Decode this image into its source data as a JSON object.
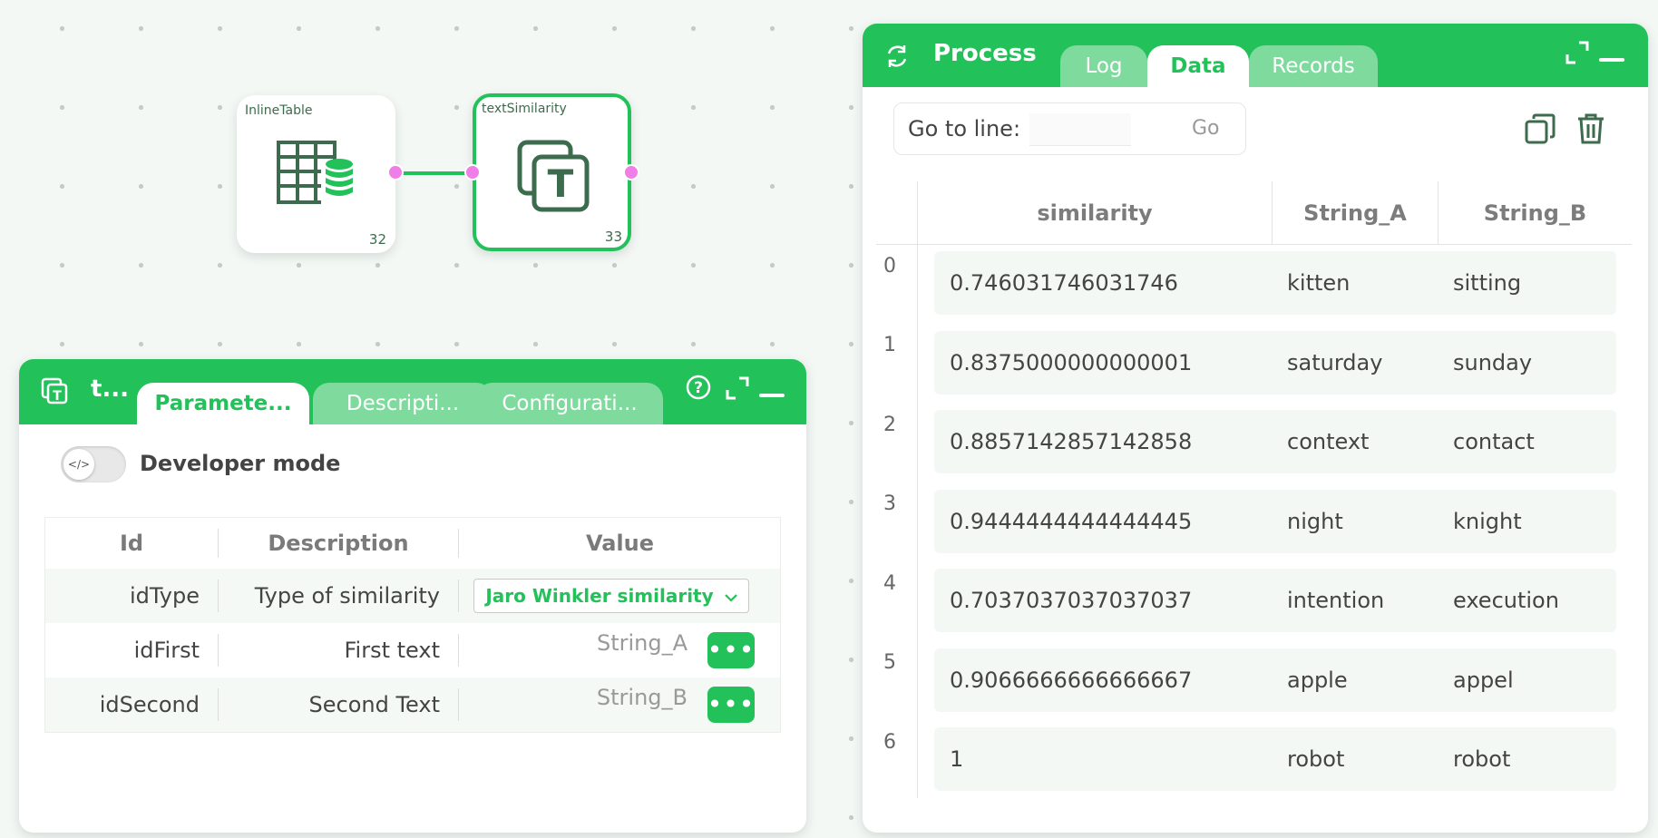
{
  "canvas": {
    "nodes": [
      {
        "title": "InlineTable",
        "id": "32",
        "icon": "table-database-icon",
        "selected": false
      },
      {
        "title": "textSimilarity",
        "id": "33",
        "icon": "text-similarity-icon",
        "selected": true
      }
    ]
  },
  "params_panel": {
    "title": "t...",
    "tabs": [
      "Paramete...",
      "Descripti...",
      "Configurati..."
    ],
    "active_tab": 0,
    "developer_mode_label": "Developer mode",
    "toggle_glyph": "</>",
    "table": {
      "headers": [
        "Id",
        "Description",
        "Value"
      ],
      "rows": [
        {
          "id": "idType",
          "description": "Type of similarity",
          "value": "Jaro Winkler similarity",
          "kind": "dropdown"
        },
        {
          "id": "idFirst",
          "description": "First text",
          "value": "String_A",
          "kind": "text"
        },
        {
          "id": "idSecond",
          "description": "Second Text",
          "value": "String_B",
          "kind": "text"
        }
      ],
      "dots": "•••"
    }
  },
  "process_panel": {
    "title": "Process",
    "tabs": [
      "Log",
      "Data",
      "Records"
    ],
    "active_tab": 1,
    "goto": {
      "label": "Go to line:",
      "value": "",
      "button": "Go"
    },
    "table": {
      "headers": [
        "similarity",
        "String_A",
        "String_B"
      ],
      "rows": [
        {
          "index": "0",
          "similarity": "0.746031746031746",
          "a": "kitten",
          "b": "sitting"
        },
        {
          "index": "1",
          "similarity": "0.8375000000000001",
          "a": "saturday",
          "b": "sunday"
        },
        {
          "index": "2",
          "similarity": "0.8857142857142858",
          "a": "context",
          "b": "contact"
        },
        {
          "index": "3",
          "similarity": "0.9444444444444445",
          "a": "night",
          "b": "knight"
        },
        {
          "index": "4",
          "similarity": "0.7037037037037037",
          "a": "intention",
          "b": "execution"
        },
        {
          "index": "5",
          "similarity": "0.9066666666666667",
          "a": "apple",
          "b": "appel"
        },
        {
          "index": "6",
          "similarity": "1",
          "a": "robot",
          "b": "robot"
        }
      ]
    }
  },
  "colors": {
    "accent": "#22c15a",
    "port": "#ef7fe6",
    "tab_inactive": "#7edb9d",
    "node_icon": "#3d6b4d"
  }
}
